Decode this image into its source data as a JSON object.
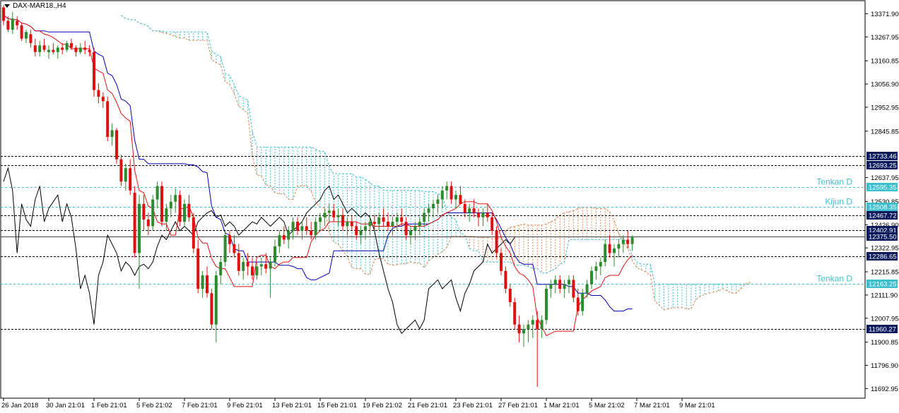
{
  "window": {
    "symbol_title": "DAX-MAR18.,H4"
  },
  "colors": {
    "bull": "#2e8b2e",
    "bear": "#e01010",
    "tenkan": "#e01010",
    "kijun": "#0000b0",
    "chikou": "#000000",
    "senkou_a": "#e08a50",
    "senkou_b": "#3bbfcf",
    "level_dark": "#000000",
    "level_light": "#3bbfcf",
    "label_dark_bg": "#0a1a5c",
    "label_light_bg": "#3bbfcf"
  },
  "chart_data": {
    "type": "candlestick",
    "instrument": "DAX-MAR18.",
    "timeframe": "H4",
    "ylim": [
      11650,
      13430
    ],
    "y_ticks": [
      "13371.90",
      "13267.95",
      "13160.85",
      "13056.90",
      "12952.95",
      "12845.85",
      "12637.95",
      "12530.85",
      "12426.90",
      "12322.95",
      "12215.85",
      "12111.90",
      "12007.95",
      "11900.85",
      "11796.90",
      "11692.95"
    ],
    "x_ticks": [
      {
        "i": 0,
        "label": "26 Jan 2018"
      },
      {
        "i": 10,
        "label": "30 Jan 21:01"
      },
      {
        "i": 20,
        "label": "1 Feb 21:01"
      },
      {
        "i": 30,
        "label": "5 Feb 21:02"
      },
      {
        "i": 40,
        "label": "7 Feb 21:01"
      },
      {
        "i": 50,
        "label": "9 Feb 21:01"
      },
      {
        "i": 60,
        "label": "13 Feb 21:01"
      },
      {
        "i": 70,
        "label": "15 Feb 21:01"
      },
      {
        "i": 80,
        "label": "19 Feb 21:02"
      },
      {
        "i": 90,
        "label": "21 Feb 21:01"
      },
      {
        "i": 100,
        "label": "23 Feb 21:01"
      },
      {
        "i": 110,
        "label": "27 Feb 21:01"
      },
      {
        "i": 120,
        "label": "1 Mar 21:01"
      },
      {
        "i": 130,
        "label": "5 Mar 21:02"
      },
      {
        "i": 140,
        "label": "7 Mar 21:01"
      },
      {
        "i": 150,
        "label": "9 Mar 21:01"
      }
    ],
    "levels": [
      {
        "value": "12733.46",
        "style": "dark",
        "tag": ""
      },
      {
        "value": "12693.25",
        "style": "dark",
        "tag": ""
      },
      {
        "value": "12595.35",
        "style": "light",
        "tag": "Tenkan D"
      },
      {
        "value": "12508.35",
        "style": "light",
        "tag": "Kijun D"
      },
      {
        "value": "12467.72",
        "style": "dark",
        "tag": ""
      },
      {
        "value": "12402.91",
        "style": "dark",
        "tag": ""
      },
      {
        "value": "12375.50",
        "style": "plain",
        "tag": ""
      },
      {
        "value": "12286.65",
        "style": "dark",
        "tag": ""
      },
      {
        "value": "12163.25",
        "style": "light",
        "tag": "Tenkan D"
      },
      {
        "value": "11960.27",
        "style": "dark",
        "tag": ""
      }
    ],
    "candles": [
      [
        13400,
        13410,
        13320,
        13340
      ],
      [
        13340,
        13360,
        13290,
        13300
      ],
      [
        13300,
        13380,
        13280,
        13350
      ],
      [
        13340,
        13360,
        13300,
        13320
      ],
      [
        13320,
        13330,
        13250,
        13260
      ],
      [
        13260,
        13300,
        13240,
        13290
      ],
      [
        13280,
        13300,
        13220,
        13240
      ],
      [
        13230,
        13260,
        13180,
        13200
      ],
      [
        13200,
        13250,
        13180,
        13230
      ],
      [
        13230,
        13260,
        13200,
        13210
      ],
      [
        13200,
        13230,
        13170,
        13210
      ],
      [
        13210,
        13240,
        13190,
        13200
      ],
      [
        13200,
        13230,
        13170,
        13220
      ],
      [
        13220,
        13240,
        13190,
        13210
      ],
      [
        13210,
        13250,
        13200,
        13240
      ],
      [
        13240,
        13260,
        13210,
        13220
      ],
      [
        13220,
        13230,
        13180,
        13200
      ],
      [
        13200,
        13240,
        13190,
        13220
      ],
      [
        13220,
        13250,
        13190,
        13210
      ],
      [
        13210,
        13230,
        13180,
        13200
      ],
      [
        13200,
        13220,
        13000,
        13030
      ],
      [
        13030,
        13060,
        12970,
        13000
      ],
      [
        13000,
        13020,
        12950,
        12980
      ],
      [
        12980,
        13000,
        12800,
        12820
      ],
      [
        12820,
        12880,
        12780,
        12850
      ],
      [
        12850,
        12860,
        12700,
        12720
      ],
      [
        12720,
        12740,
        12600,
        12620
      ],
      [
        12620,
        12700,
        12580,
        12680
      ],
      [
        12680,
        12720,
        12560,
        12580
      ],
      [
        12570,
        12600,
        12280,
        12300
      ],
      [
        12300,
        12560,
        12140,
        12520
      ],
      [
        12520,
        12560,
        12400,
        12450
      ],
      [
        12450,
        12480,
        12380,
        12420
      ],
      [
        12420,
        12560,
        12400,
        12540
      ],
      [
        12540,
        12620,
        12500,
        12600
      ],
      [
        12600,
        12620,
        12420,
        12440
      ],
      [
        12440,
        12520,
        12400,
        12500
      ],
      [
        12500,
        12560,
        12460,
        12530
      ],
      [
        12530,
        12590,
        12480,
        12560
      ],
      [
        12560,
        12580,
        12420,
        12440
      ],
      [
        12440,
        12540,
        12420,
        12520
      ],
      [
        12520,
        12560,
        12440,
        12460
      ],
      [
        12460,
        12480,
        12300,
        12320
      ],
      [
        12320,
        12360,
        12120,
        12140
      ],
      [
        12140,
        12220,
        12100,
        12200
      ],
      [
        12200,
        12240,
        12100,
        12120
      ],
      [
        12120,
        12140,
        11960,
        11980
      ],
      [
        11980,
        12220,
        11900,
        12200
      ],
      [
        12200,
        12280,
        12160,
        12260
      ],
      [
        12260,
        12400,
        12240,
        12380
      ],
      [
        12380,
        12400,
        12300,
        12340
      ],
      [
        12340,
        12380,
        12280,
        12300
      ],
      [
        12300,
        12340,
        12200,
        12220
      ],
      [
        12220,
        12280,
        12180,
        12260
      ],
      [
        12260,
        12300,
        12200,
        12240
      ],
      [
        12240,
        12280,
        12180,
        12200
      ],
      [
        12200,
        12260,
        12180,
        12240
      ],
      [
        12240,
        12280,
        12200,
        12250
      ],
      [
        12250,
        12300,
        12210,
        12230
      ],
      [
        12230,
        12280,
        12100,
        12260
      ],
      [
        12260,
        12360,
        12240,
        12330
      ],
      [
        12330,
        12400,
        12300,
        12380
      ],
      [
        12380,
        12420,
        12340,
        12360
      ],
      [
        12360,
        12420,
        12320,
        12400
      ],
      [
        12400,
        12460,
        12360,
        12440
      ],
      [
        12440,
        12460,
        12380,
        12400
      ],
      [
        12400,
        12440,
        12360,
        12420
      ],
      [
        12420,
        12460,
        12380,
        12400
      ],
      [
        12400,
        12440,
        12360,
        12380
      ],
      [
        12380,
        12460,
        12360,
        12440
      ],
      [
        12440,
        12480,
        12400,
        12460
      ],
      [
        12460,
        12500,
        12420,
        12480
      ],
      [
        12480,
        12520,
        12440,
        12490
      ],
      [
        12490,
        12520,
        12440,
        12460
      ],
      [
        12460,
        12500,
        12420,
        12470
      ],
      [
        12470,
        12500,
        12400,
        12420
      ],
      [
        12420,
        12460,
        12380,
        12440
      ],
      [
        12440,
        12470,
        12400,
        12420
      ],
      [
        12420,
        12440,
        12360,
        12380
      ],
      [
        12380,
        12420,
        12340,
        12400
      ],
      [
        12400,
        12440,
        12360,
        12420
      ],
      [
        12420,
        12460,
        12380,
        12440
      ],
      [
        12440,
        12470,
        12400,
        12430
      ],
      [
        12430,
        12480,
        12400,
        12460
      ],
      [
        12460,
        12500,
        12420,
        12440
      ],
      [
        12440,
        12480,
        12400,
        12420
      ],
      [
        12420,
        12460,
        12380,
        12440
      ],
      [
        12440,
        12480,
        12400,
        12460
      ],
      [
        12460,
        12500,
        12420,
        12440
      ],
      [
        12440,
        12460,
        12360,
        12380
      ],
      [
        12380,
        12420,
        12340,
        12400
      ],
      [
        12400,
        12440,
        12360,
        12420
      ],
      [
        12420,
        12460,
        12380,
        12440
      ],
      [
        12440,
        12500,
        12420,
        12480
      ],
      [
        12480,
        12520,
        12440,
        12500
      ],
      [
        12500,
        12540,
        12460,
        12520
      ],
      [
        12520,
        12560,
        12480,
        12540
      ],
      [
        12540,
        12600,
        12500,
        12580
      ],
      [
        12580,
        12620,
        12540,
        12600
      ],
      [
        12600,
        12620,
        12520,
        12540
      ],
      [
        12540,
        12580,
        12500,
        12560
      ],
      [
        12560,
        12600,
        12520,
        12520
      ],
      [
        12520,
        12540,
        12460,
        12480
      ],
      [
        12480,
        12520,
        12440,
        12500
      ],
      [
        12500,
        12540,
        12460,
        12480
      ],
      [
        12480,
        12500,
        12420,
        12460
      ],
      [
        12460,
        12500,
        12420,
        12480
      ],
      [
        12480,
        12520,
        12440,
        12460
      ],
      [
        12460,
        12480,
        12380,
        12400
      ],
      [
        12400,
        12420,
        12280,
        12300
      ],
      [
        12300,
        12320,
        12200,
        12220
      ],
      [
        12220,
        12240,
        12120,
        12140
      ],
      [
        12140,
        12160,
        12060,
        12080
      ],
      [
        12080,
        12100,
        11960,
        11980
      ],
      [
        11980,
        12020,
        11900,
        11940
      ],
      [
        11940,
        11980,
        11880,
        11960
      ],
      [
        11960,
        12000,
        11900,
        11980
      ],
      [
        11980,
        12020,
        11920,
        12000
      ],
      [
        12000,
        12040,
        11700,
        11960
      ],
      [
        11960,
        12020,
        11920,
        12000
      ],
      [
        12000,
        12160,
        11980,
        12140
      ],
      [
        12140,
        12180,
        12100,
        12160
      ],
      [
        12160,
        12200,
        12120,
        12180
      ],
      [
        12180,
        12200,
        12120,
        12140
      ],
      [
        12140,
        12180,
        12100,
        12160
      ],
      [
        12160,
        12200,
        12120,
        12180
      ],
      [
        12180,
        12200,
        12080,
        12100
      ],
      [
        12100,
        12140,
        12020,
        12040
      ],
      [
        12040,
        12140,
        12020,
        12120
      ],
      [
        12120,
        12180,
        12100,
        12160
      ],
      [
        12160,
        12240,
        12140,
        12220
      ],
      [
        12220,
        12260,
        12180,
        12240
      ],
      [
        12240,
        12280,
        12200,
        12260
      ],
      [
        12260,
        12360,
        12240,
        12340
      ],
      [
        12340,
        12380,
        12280,
        12300
      ],
      [
        12300,
        12340,
        12240,
        12320
      ],
      [
        12320,
        12360,
        12280,
        12340
      ],
      [
        12340,
        12380,
        12300,
        12360
      ],
      [
        12360,
        12400,
        12320,
        12340
      ],
      [
        12340,
        12380,
        12310,
        12370
      ]
    ]
  }
}
